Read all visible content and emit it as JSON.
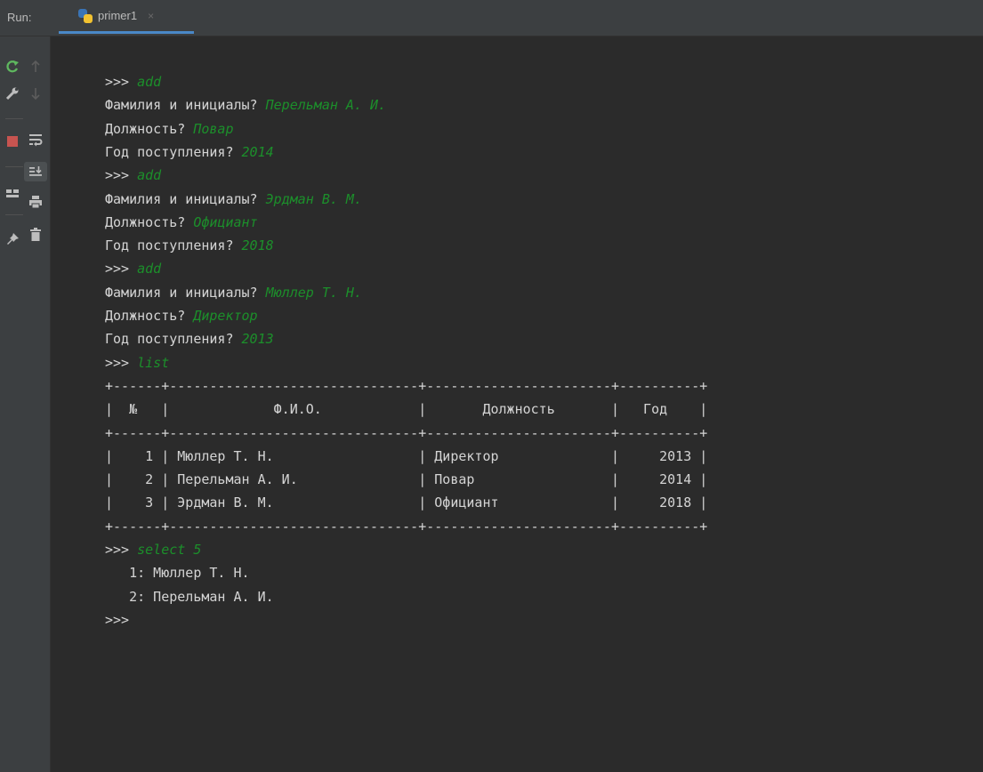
{
  "run_panel": {
    "label": "Run:",
    "tab_title": "primer1",
    "tab_close": "×"
  },
  "icons": {
    "rerun": "rerun-icon",
    "wrench": "wrench-icon",
    "stop": "stop-icon",
    "layout": "layout-icon",
    "pin": "pin-icon",
    "up": "up-arrow-icon",
    "down": "down-arrow-icon",
    "soft_wrap": "soft-wrap-icon",
    "scroll_end": "scroll-to-end-icon",
    "print": "print-icon",
    "trash": "trash-icon"
  },
  "colors": {
    "background": "#2b2b2b",
    "user_input": "#1c8f2b",
    "text": "#d4d4d4",
    "tab_underline": "#4a88c7",
    "stop": "#c75450"
  },
  "console": {
    "lines": [
      {
        "prompt": ">>> ",
        "input": "add"
      },
      {
        "prompt": "Фамилия и инициалы? ",
        "input": "Перельман А. И."
      },
      {
        "prompt": "Должность? ",
        "input": "Повар"
      },
      {
        "prompt": "Год поступления? ",
        "input": "2014"
      },
      {
        "prompt": ">>> ",
        "input": "add"
      },
      {
        "prompt": "Фамилия и инициалы? ",
        "input": "Эрдман В. М."
      },
      {
        "prompt": "Должность? ",
        "input": "Официант"
      },
      {
        "prompt": "Год поступления? ",
        "input": "2018"
      },
      {
        "prompt": ">>> ",
        "input": "add"
      },
      {
        "prompt": "Фамилия и инициалы? ",
        "input": "Мюллер Т. Н."
      },
      {
        "prompt": "Должность? ",
        "input": "Директор"
      },
      {
        "prompt": "Год поступления? ",
        "input": "2013"
      },
      {
        "prompt": ">>> ",
        "input": "list"
      },
      {
        "prompt": "+------+-------------------------------+-----------------------+----------+",
        "input": ""
      },
      {
        "prompt": "|  №   |             Ф.И.О.            |       Должность       |   Год    |",
        "input": ""
      },
      {
        "prompt": "+------+-------------------------------+-----------------------+----------+",
        "input": ""
      },
      {
        "prompt": "|    1 | Мюллер Т. Н.                  | Директор              |     2013 |",
        "input": ""
      },
      {
        "prompt": "|    2 | Перельман А. И.               | Повар                 |     2014 |",
        "input": ""
      },
      {
        "prompt": "|    3 | Эрдман В. М.                  | Официант              |     2018 |",
        "input": ""
      },
      {
        "prompt": "+------+-------------------------------+-----------------------+----------+",
        "input": ""
      },
      {
        "prompt": ">>> ",
        "input": "select 5"
      },
      {
        "prompt": "   1: Мюллер Т. Н.",
        "input": ""
      },
      {
        "prompt": "   2: Перельман А. И.",
        "input": ""
      },
      {
        "prompt": ">>> ",
        "input": ""
      }
    ]
  }
}
